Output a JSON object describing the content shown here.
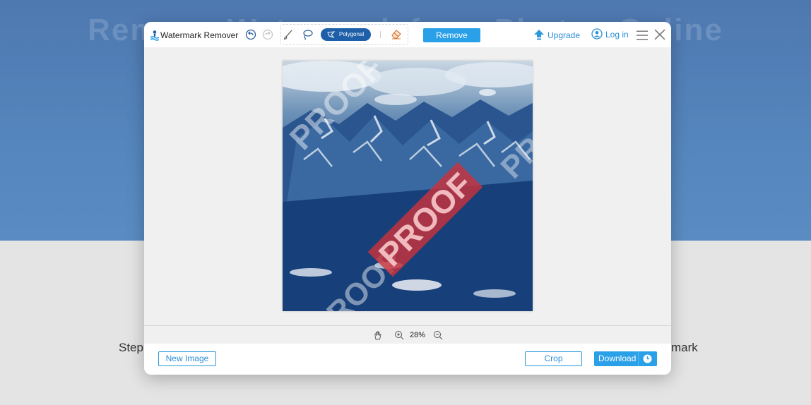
{
  "page": {
    "background_heading": "Remove Watermark from Photos Online",
    "bg_step_text": "Step",
    "bg_tail_text": "mark"
  },
  "app": {
    "title": "Watermark Remover",
    "icon": "watermark-logo-icon"
  },
  "toolbar": {
    "undo_icon": "undo-icon",
    "redo_icon": "redo-icon",
    "brush_icon": "brush-icon",
    "lasso_icon": "lasso-icon",
    "polygonal_label": "Polygonal",
    "eraser_icon": "eraser-icon",
    "remove_label": "Remove",
    "upgrade_label": "Upgrade",
    "login_label": "Log in",
    "menu_icon": "hamburger-menu-icon",
    "close_icon": "close-icon"
  },
  "image": {
    "watermark_text": "PROOF",
    "colors": {
      "watermark": "#c8323c"
    }
  },
  "zoom": {
    "level": "28%",
    "hand_icon": "hand-pan-icon",
    "zoom_in_icon": "zoom-in-icon",
    "zoom_out_icon": "zoom-out-icon"
  },
  "footer": {
    "new_image_label": "New Image",
    "crop_label": "Crop",
    "download_label": "Download",
    "download_icon": "clock-icon"
  },
  "colors": {
    "accent": "#2aa0e8",
    "polygon_active": "#1d5fa8",
    "link": "#2a8fd8"
  }
}
